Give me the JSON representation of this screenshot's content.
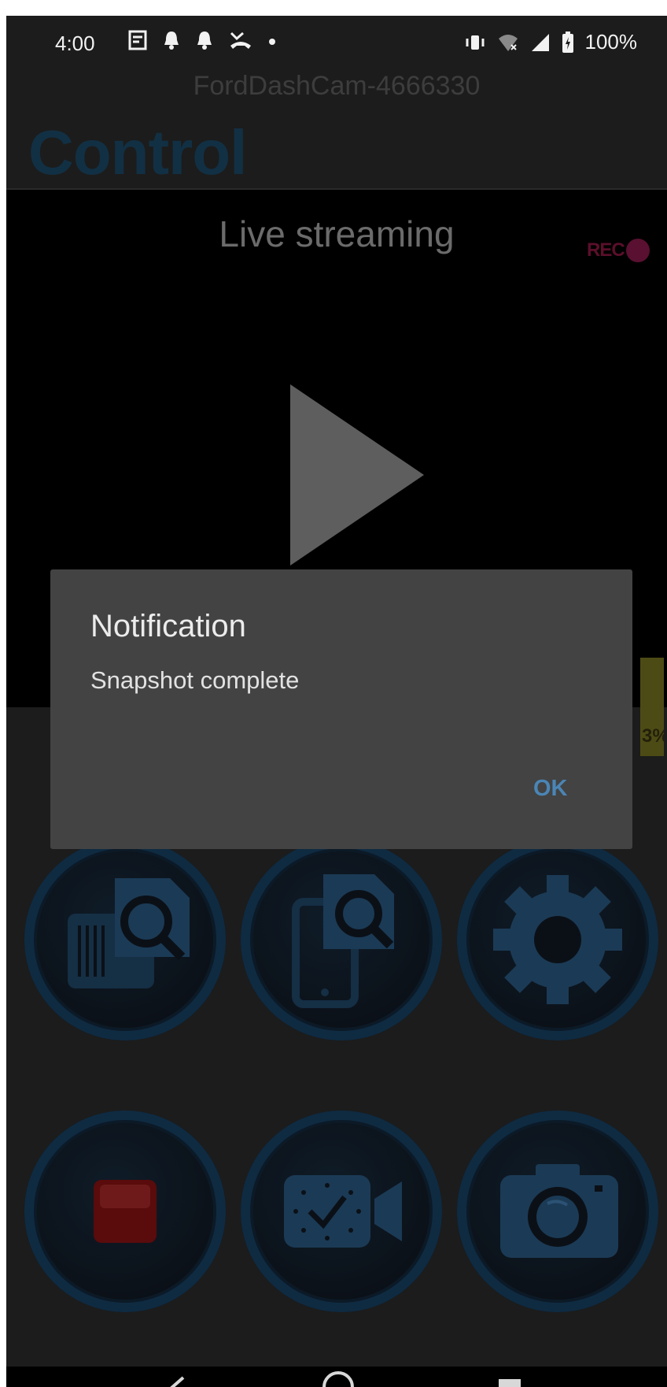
{
  "status_bar": {
    "time": "4:00",
    "battery_percent": "100%",
    "icons_left": [
      "notes-icon",
      "bell-icon",
      "bell-icon",
      "missed-call-icon",
      "dot-icon"
    ],
    "icons_right": [
      "vibrate-icon",
      "wifi-icon",
      "cell-signal-icon",
      "battery-icon"
    ]
  },
  "header": {
    "device_name": "FordDashCam-4666330",
    "title": "Control"
  },
  "video": {
    "label": "Live streaming",
    "rec_label": "REC",
    "side_chip_text": "3%"
  },
  "controls": [
    {
      "name": "sd-card-gallery",
      "icon": "sd-card-search-icon"
    },
    {
      "name": "phone-gallery",
      "icon": "phone-search-icon"
    },
    {
      "name": "settings",
      "icon": "gear-icon"
    },
    {
      "name": "stop-record",
      "icon": "stop-icon"
    },
    {
      "name": "timed-video",
      "icon": "clock-video-icon"
    },
    {
      "name": "snapshot",
      "icon": "camera-icon"
    }
  ],
  "dialog": {
    "title": "Notification",
    "message": "Snapshot complete",
    "ok_label": "OK"
  },
  "colors": {
    "accent_blue": "#123044",
    "dialog_bg": "#434343",
    "ok_text": "#4a85b5",
    "rec_red": "#5a1030"
  }
}
